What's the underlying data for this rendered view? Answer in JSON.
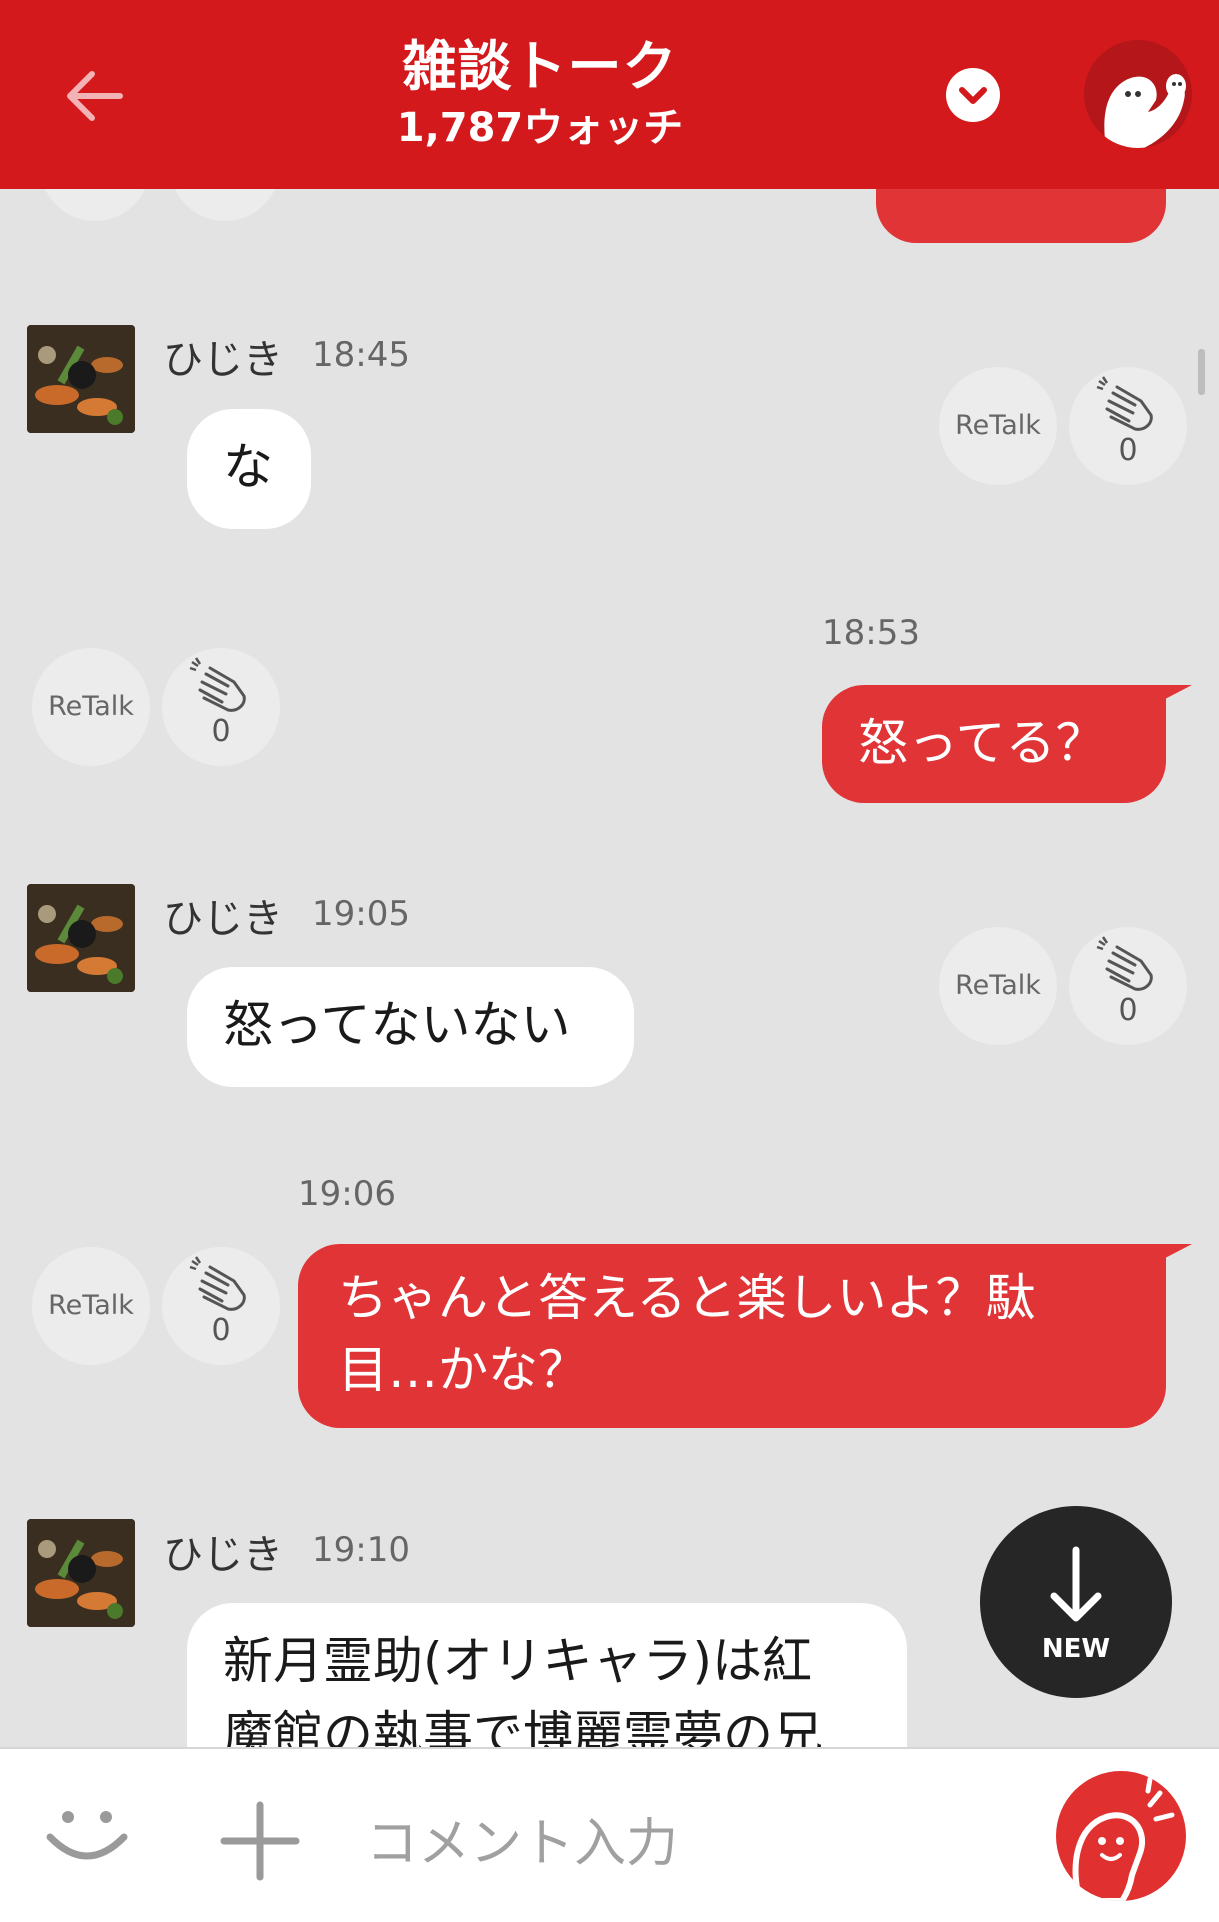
{
  "header": {
    "title": "雑談トーク",
    "watch_count": "1,787ウォッチ"
  },
  "messages": [
    {
      "type": "in",
      "name": "ひじき",
      "time": "18:45",
      "text": "な",
      "retalk": "ReTalk",
      "clap_count": "0"
    },
    {
      "type": "out",
      "time": "18:53",
      "text": "怒ってる？",
      "retalk": "ReTalk",
      "clap_count": "0"
    },
    {
      "type": "in",
      "name": "ひじき",
      "time": "19:05",
      "text": "怒ってないない",
      "retalk": "ReTalk",
      "clap_count": "0"
    },
    {
      "type": "out",
      "time": "19:06",
      "line1": "ちゃんと答えると楽しいよ？駄",
      "line2": "目…かな？",
      "retalk": "ReTalk",
      "clap_count": "0"
    },
    {
      "type": "in",
      "name": "ひじき",
      "time": "19:10",
      "line1": "新月霊助(オリキャラ)は紅",
      "line2": "魔館の執事で博麗霊夢の兄"
    }
  ],
  "new_button": {
    "label": "NEW"
  },
  "input": {
    "placeholder": "コメント入力"
  },
  "colors": {
    "brand": "#d3191c",
    "outgoing": "#e03437",
    "background": "#e3e3e3"
  }
}
